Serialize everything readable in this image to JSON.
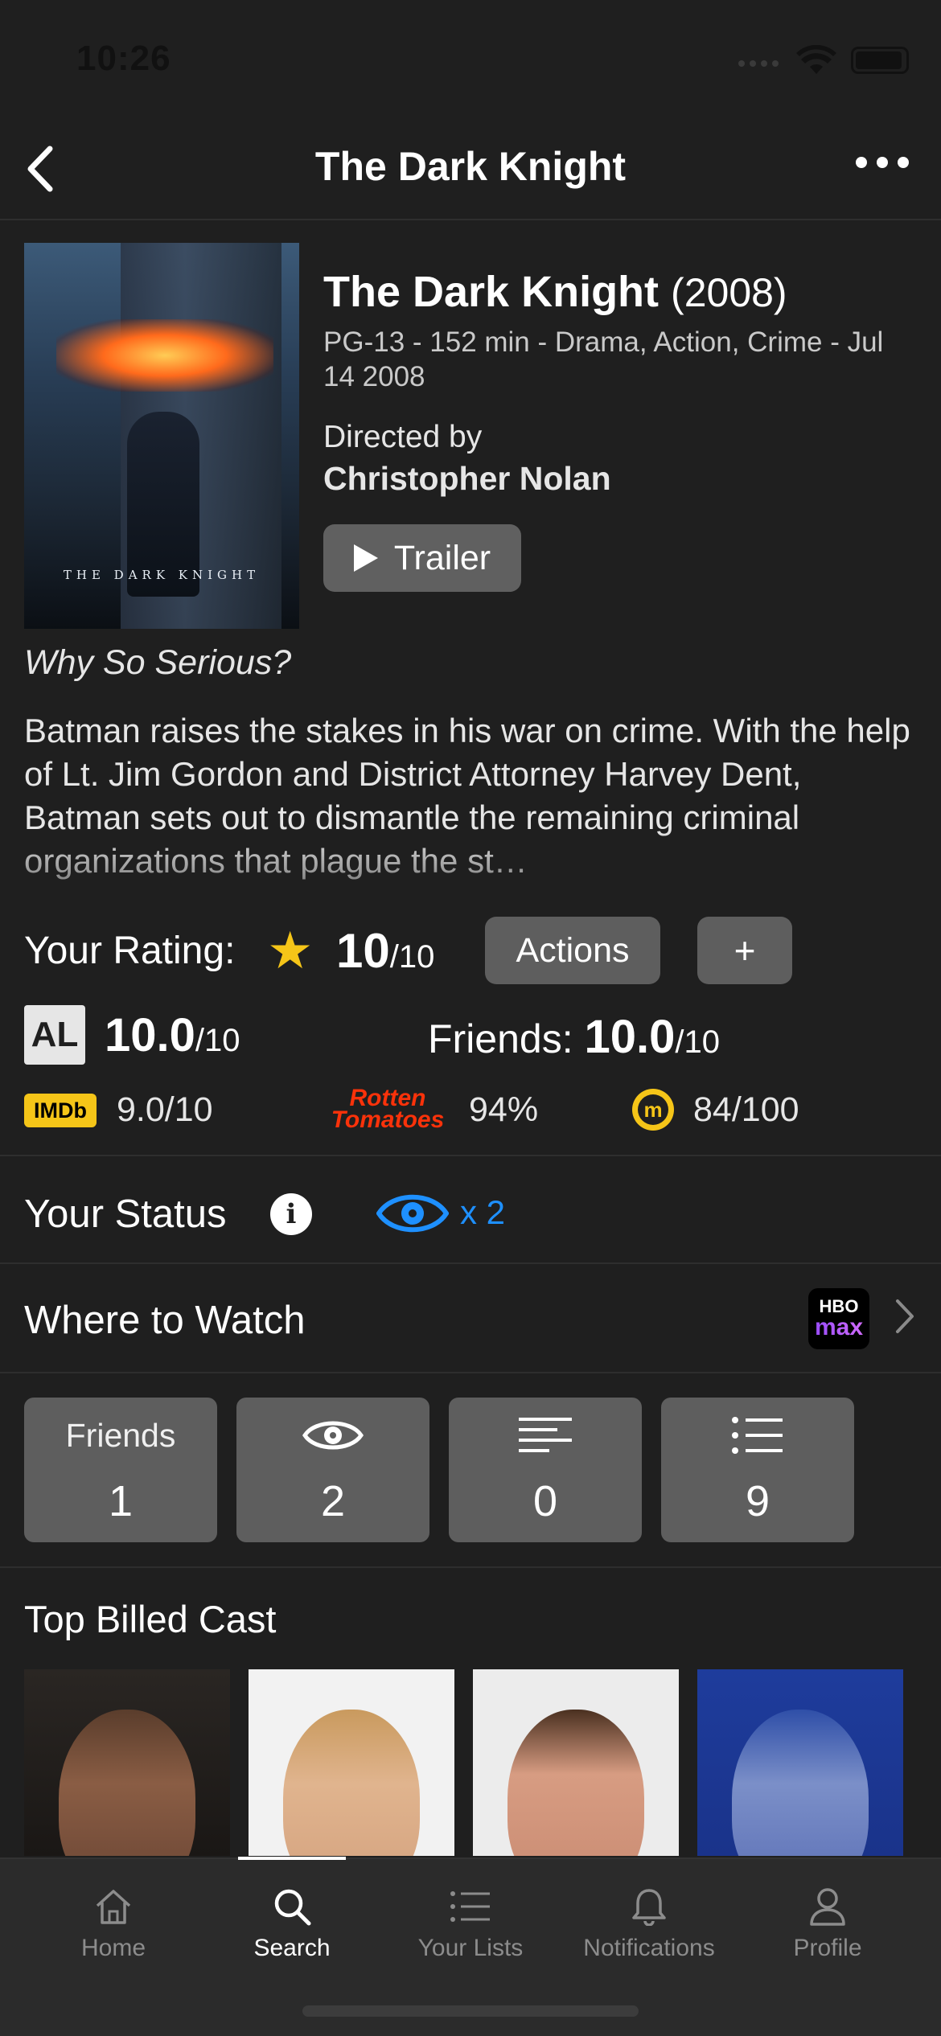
{
  "status_bar": {
    "time": "10:26"
  },
  "nav": {
    "title": "The Dark Knight"
  },
  "poster": {
    "caption": "THE DARK KNIGHT"
  },
  "movie": {
    "title": "The Dark Knight",
    "year": "(2008)",
    "meta": "PG-13 - 152 min - Drama, Action, Crime - Jul 14 2008",
    "directed_by_label": "Directed by",
    "director": "Christopher Nolan",
    "trailer_label": "Trailer",
    "tagline": "Why So Serious?",
    "overview": "Batman raises the stakes in his war on crime. With the help of Lt. Jim Gordon and District Attorney Harvey Dent, Batman sets out to dismantle the remaining criminal organizations that plague the st…"
  },
  "rating": {
    "label": "Your Rating:",
    "value": "10",
    "suffix": "/10",
    "actions_label": "Actions",
    "add_label": "+"
  },
  "scores": {
    "al_badge": "AL",
    "al_value": "10.0",
    "al_suffix": "/10",
    "friends_label": "Friends:",
    "friends_value": "10.0",
    "friends_suffix": "/10",
    "imdb_badge": "IMDb",
    "imdb": "9.0/10",
    "rt_logo_line1": "Rotten",
    "rt_logo_line2": "Tomatoes",
    "rt": "94%",
    "mc_logo": "m",
    "metacritic": "84/100"
  },
  "status": {
    "label": "Your Status",
    "info": "i",
    "watched_count": "x 2"
  },
  "where_to_watch": {
    "label": "Where to Watch",
    "provider_line1": "HBO",
    "provider_line2": "max"
  },
  "tiles": [
    {
      "label": "Friends",
      "value": "1"
    },
    {
      "value": "2"
    },
    {
      "value": "0"
    },
    {
      "value": "9"
    }
  ],
  "cast": {
    "heading": "Top Billed Cast"
  },
  "tabbar": {
    "items": [
      {
        "label": "Home"
      },
      {
        "label": "Search"
      },
      {
        "label": "Your Lists"
      },
      {
        "label": "Notifications"
      },
      {
        "label": "Profile"
      }
    ],
    "active": "Search"
  },
  "colors": {
    "background": "#1f1f1f",
    "button": "#5e5e5e",
    "accent_blue": "#1e90ff",
    "star": "#f5c518",
    "rt_red": "#fa320a"
  }
}
